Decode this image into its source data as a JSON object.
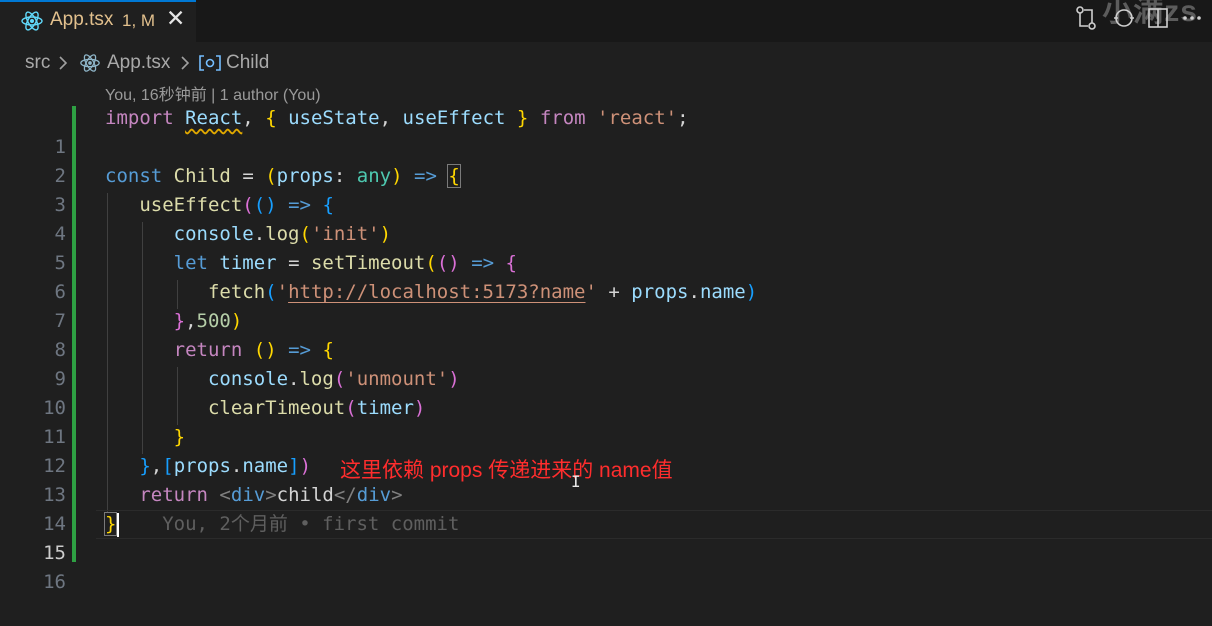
{
  "tab": {
    "label": "App.tsx",
    "status": "1, M",
    "close": "✕"
  },
  "watermark": "小满zs",
  "breadcrumb": {
    "root": "src",
    "file": "App.tsx",
    "symbol": "Child"
  },
  "codelens": "You, 16秒钟前 | 1 author (You)",
  "line_numbers": [
    "1",
    "2",
    "3",
    "4",
    "5",
    "6",
    "7",
    "8",
    "9",
    "10",
    "11",
    "12",
    "13",
    "14",
    "15",
    "16"
  ],
  "active_line": "15",
  "code": {
    "l1": {
      "import": "import",
      "react": "React",
      "lb": "{",
      "useState": "useState",
      "useEffect": "useEffect",
      "rb": "}",
      "from": "from",
      "mod": "'react'",
      "semi": ";"
    },
    "l3": {
      "const": "const",
      "name": "Child",
      "eq": "=",
      "lp": "(",
      "props": "props",
      "colon": ":",
      "any": "any",
      "rp": ")",
      "arrow": "=>",
      "lb": "{"
    },
    "l4": {
      "fn": "useEffect",
      "lp": "(",
      "lp2": "(",
      "rp2": ")",
      "arrow": "=>",
      "lb": "{"
    },
    "l5": {
      "obj": "console",
      "dot": ".",
      "fn": "log",
      "lp": "(",
      "str": "'init'",
      "rp": ")"
    },
    "l6": {
      "let": "let",
      "var": "timer",
      "eq": "=",
      "fn": "setTimeout",
      "lp": "(",
      "lp2": "(",
      "rp2": ")",
      "arrow": "=>",
      "lb": "{"
    },
    "l7": {
      "fn": "fetch",
      "lp": "(",
      "q1": "'",
      "url": "http://localhost:5173?name",
      "q2": "'",
      "plus": "+",
      "obj": "props",
      "dot": ".",
      "prop": "name",
      "rp": ")"
    },
    "l8": {
      "rb": "}",
      "comma": ",",
      "num": "500",
      "rp": ")"
    },
    "l9": {
      "ret": "return",
      "lp": "(",
      "rp": ")",
      "arrow": "=>",
      "lb": "{"
    },
    "l10": {
      "obj": "console",
      "dot": ".",
      "fn": "log",
      "lp": "(",
      "str": "'unmount'",
      "rp": ")"
    },
    "l11": {
      "fn": "clearTimeout",
      "lp": "(",
      "var": "timer",
      "rp": ")"
    },
    "l12": {
      "rb": "}"
    },
    "l13": {
      "rb": "}",
      "comma": ",",
      "lsq": "[",
      "obj": "props",
      "dot": ".",
      "prop": "name",
      "rsq": "]",
      "rp": ")"
    },
    "l14": {
      "ret": "return",
      "lt": "<",
      "tag": "div",
      "gt": ">",
      "text": "child",
      "lt2": "</",
      "tag2": "div",
      "gt2": ">"
    },
    "l15": {
      "rb": "}",
      "blame": "You, 2个月前 • first commit"
    }
  },
  "annotation": "这里依赖 props 传递进来的 name值",
  "colors": {
    "accent": "#0078d4",
    "modified": "#e2c08d",
    "annotation": "#ff2d2d",
    "git_added": "#2ea043"
  },
  "icons": [
    "react-icon",
    "close-icon",
    "chevron-right-icon",
    "symbol-class-icon",
    "git-compare-icon",
    "history-icon",
    "split-editor-icon",
    "more-icon"
  ]
}
